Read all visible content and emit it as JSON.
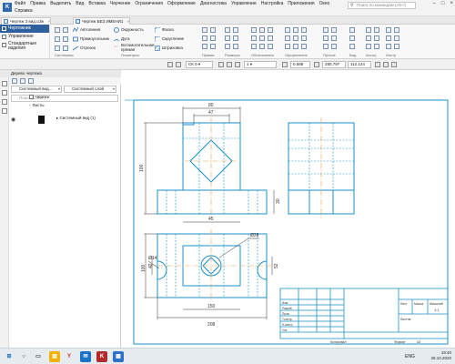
{
  "menubar": {
    "app_icon": "K",
    "items": [
      "Файл",
      "Правка",
      "Выделить",
      "Вид",
      "Вставка",
      "Черчение",
      "Ограничения",
      "Оформление",
      "Диагностика",
      "Управление",
      "Настройка",
      "Приложения",
      "Окно"
    ],
    "second_row": "Справка",
    "search_placeholder": "Поиск по командам (Alt+/)",
    "search_icon": "magnifier-icon",
    "window_controls": [
      "–",
      "□",
      "×"
    ]
  },
  "tabs": [
    {
      "label": "Чертеж 3 вид.cdw",
      "close": "×"
    },
    {
      "label": "Чертеж БЕЗ ИМЕНИ1",
      "close": "×"
    }
  ],
  "ribbon": {
    "modes": [
      "Чертежник",
      "Управление",
      "Стандартные изделия"
    ],
    "group1": {
      "items": [
        "Автолиния",
        "Прямоугольник",
        "Отрезок"
      ],
      "label": "Системная"
    },
    "group2": {
      "items": [
        "Окружность",
        "Дуга",
        "Вспомогательная прямая"
      ],
      "label": "Геометрия"
    },
    "group3": {
      "items": [
        "Фаска",
        "Скругление",
        "Штриховка"
      ]
    },
    "group_labels_right": [
      "Правка",
      "Размеры",
      "Обозначения",
      "Оформление",
      "Прочие",
      "Вид",
      "Ассоц",
      "Инстр"
    ]
  },
  "propbar": {
    "style_value": "СК 0",
    "layer_value": "1",
    "zoom_value": "0.588",
    "x_value": "280.797",
    "y_value": "112.124"
  },
  "leftpanel": {
    "title": "Дерево чертежа",
    "combo1": "Системный вид...",
    "combo2": "Системный слой",
    "search_placeholder": "Поиск (Ctrl+F)",
    "tree": [
      "Чертеж",
      "Листы",
      "Системный вид (1)"
    ]
  },
  "drawing": {
    "dims": {
      "top_width_1": "80",
      "top_width_2": "47",
      "height_left": "100",
      "bottom_width": "45",
      "small_right": "30",
      "plan_height": "100",
      "plan_dia": "Ø28",
      "left_dia": "Ø14",
      "left_small": "42",
      "right_small": "52",
      "plan_width_1": "150",
      "plan_width_2": "208"
    },
    "title_block": {
      "sheet_label": "Лист",
      "sheets_label": "Листов",
      "mass_label": "Масса",
      "scale_label": "Масштаб",
      "scale_value": "1:1",
      "copied_label": "Копировал",
      "format_label": "Формат",
      "format_value": "A3",
      "rows": [
        "Изм.",
        "Разраб.",
        "Пров.",
        "Т.контр.",
        "Н.контр.",
        "Утв."
      ]
    }
  },
  "taskbar": {
    "icons": [
      "windows-icon",
      "search-icon",
      "task-view-icon",
      "yandex-icon",
      "explorer-icon",
      "mail-icon",
      "kompas-icon"
    ],
    "lang": "ENG",
    "time": "19:40",
    "date": "28.10.2020"
  },
  "colors": {
    "outline": "#1d8fc4",
    "ribbon_active": "#2f5f9e",
    "axis": "#e2a04a",
    "dimension": "#333333"
  }
}
